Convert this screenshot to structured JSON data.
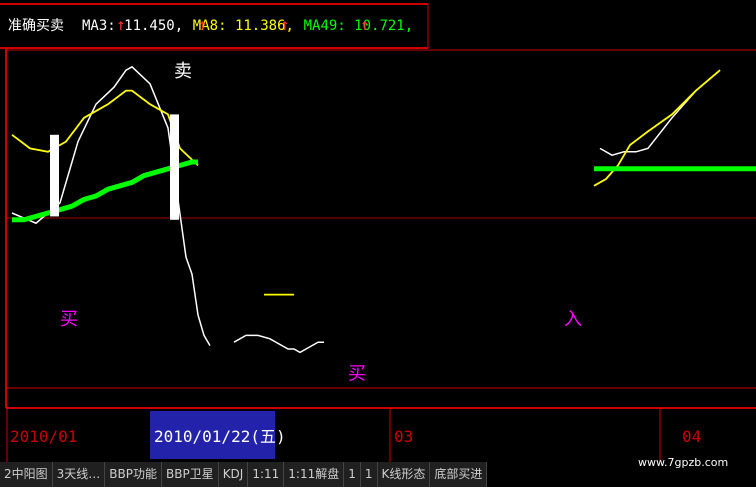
{
  "chart_data": {
    "type": "line",
    "indicator_name": "准确买卖",
    "legend": [
      {
        "label": "MA3: 11.450",
        "color": "#ffffff"
      },
      {
        "label": "MA8: 11.386",
        "color": "#ffff00"
      },
      {
        "label": "MA49: 10.721",
        "color": "#00ff00"
      }
    ],
    "ylim": [
      0,
      100
    ],
    "series": [
      {
        "key": "ma3",
        "color": "#ffffff",
        "segments": [
          [
            [
              0,
              55
            ],
            [
              4,
              52
            ],
            [
              6,
              55
            ],
            [
              8,
              58
            ],
            [
              10,
              70
            ],
            [
              11,
              76
            ],
            [
              14,
              87
            ],
            [
              17,
              92
            ],
            [
              19,
              97
            ],
            [
              20,
              98
            ],
            [
              23,
              93
            ],
            [
              26,
              80
            ],
            [
              29,
              42
            ],
            [
              30,
              37
            ],
            [
              31,
              25
            ],
            [
              32,
              19
            ],
            [
              33,
              16
            ]
          ],
          [
            [
              37,
              17
            ],
            [
              39,
              19
            ],
            [
              41,
              19
            ],
            [
              43,
              18
            ],
            [
              45,
              16
            ],
            [
              46,
              15
            ],
            [
              47,
              15
            ],
            [
              48,
              14
            ],
            [
              49,
              15
            ],
            [
              50,
              16
            ],
            [
              51,
              17
            ],
            [
              52,
              17
            ]
          ],
          [
            [
              98,
              74
            ],
            [
              100,
              72
            ],
            [
              102,
              73
            ],
            [
              104,
              73
            ],
            [
              106,
              74
            ],
            [
              110,
              83
            ],
            [
              114,
              91
            ],
            [
              118,
              97
            ]
          ]
        ]
      },
      {
        "key": "ma8",
        "color": "#ffff00",
        "segments": [
          [
            [
              0,
              78
            ],
            [
              3,
              74
            ],
            [
              6,
              73
            ],
            [
              9,
              76
            ],
            [
              12,
              83
            ],
            [
              16,
              87
            ],
            [
              19,
              91
            ],
            [
              20,
              91
            ],
            [
              23,
              87
            ],
            [
              26,
              84
            ],
            [
              28,
              74
            ],
            [
              31,
              69
            ]
          ],
          [
            [
              42,
              31
            ],
            [
              44,
              31
            ],
            [
              46,
              31
            ],
            [
              47,
              31
            ]
          ],
          [
            [
              97,
              63
            ],
            [
              99,
              65
            ],
            [
              101,
              69
            ],
            [
              103,
              75
            ],
            [
              106,
              79
            ],
            [
              110,
              84
            ],
            [
              114,
              91
            ],
            [
              118,
              97
            ]
          ]
        ]
      },
      {
        "key": "ma49",
        "color": "#00ff00",
        "segments": [
          [
            [
              0,
              53
            ],
            [
              2,
              53
            ],
            [
              4,
              54
            ],
            [
              6,
              55
            ],
            [
              8,
              56
            ],
            [
              10,
              57
            ],
            [
              12,
              59
            ],
            [
              14,
              60
            ],
            [
              16,
              62
            ],
            [
              18,
              63
            ],
            [
              20,
              64
            ],
            [
              22,
              66
            ],
            [
              24,
              67
            ],
            [
              26,
              68
            ],
            [
              28,
              69
            ],
            [
              30,
              70
            ],
            [
              31,
              70
            ]
          ],
          [
            [
              97,
              68
            ],
            [
              100,
              68
            ],
            [
              104,
              68
            ],
            [
              110,
              68
            ],
            [
              118,
              68
            ],
            [
              124,
              68
            ]
          ]
        ]
      }
    ],
    "annotations": [
      {
        "text": "卖",
        "color": "#ffffff",
        "x": 27,
        "y": 95,
        "kind": "sell"
      },
      {
        "text": "买",
        "color": "#ff00ff",
        "x": 8,
        "y": 22,
        "kind": "buy"
      },
      {
        "text": "买",
        "color": "#ff00ff",
        "x": 56,
        "y": 6,
        "kind": "buy"
      },
      {
        "text": "入",
        "color": "#ff00ff",
        "x": 92,
        "y": 22,
        "kind": "buy"
      }
    ],
    "bars": [
      {
        "x": 7,
        "y0": 54,
        "y1": 78
      },
      {
        "x": 27,
        "y0": 53,
        "y1": 84
      }
    ],
    "x_ticks": [
      {
        "label": "2010/01",
        "x": 0,
        "highlight": false
      },
      {
        "label": "2010/01/22(五)",
        "x": 24,
        "highlight": true
      },
      {
        "label": "03",
        "x": 64,
        "highlight": false
      },
      {
        "label": "04",
        "x": 112,
        "highlight": false
      }
    ],
    "grid": true
  },
  "tabs": [
    "2中阳图",
    "3天线…",
    "BBP功能",
    "BBP卫星",
    "KDJ",
    "1:11",
    "1:11解盘",
    "1",
    "1",
    "K线形态",
    "底部买进"
  ],
  "watermark": "www.7gpzb.com"
}
